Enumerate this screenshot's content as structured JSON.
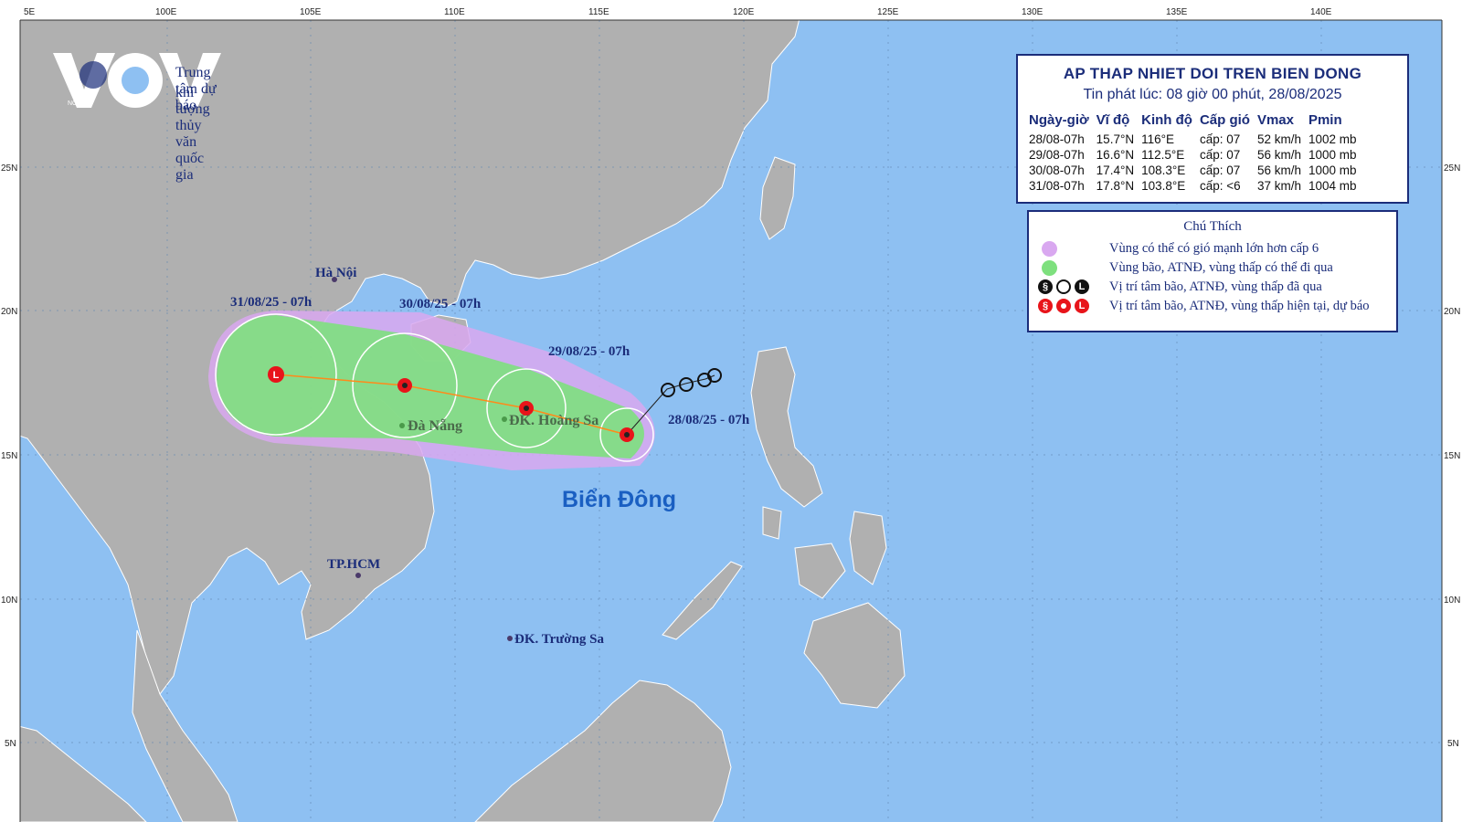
{
  "logo": {
    "brand": "VOV",
    "org_line1": "Trung tâm dự báo",
    "org_line2": "khí tượng thủy văn quốc gia",
    "badge": "NCHMF"
  },
  "grid": {
    "lon_labels": [
      "100E",
      "105E",
      "110E",
      "115E",
      "120E",
      "125E",
      "130E",
      "135E",
      "140E"
    ],
    "lat_labels": [
      "25N",
      "20N",
      "15N",
      "10N",
      "5N"
    ],
    "corner_label": "5E"
  },
  "places": {
    "hanoi": "Hà Nội",
    "danang": "Đà Nẵng",
    "hoangsa": "ĐK. Hoàng Sa",
    "tphcm": "TP.HCM",
    "truongsa": "ĐK. Trường Sa",
    "sea": "Biển Đông"
  },
  "track_labels": {
    "p1": "28/08/25 - 07h",
    "p2": "29/08/25 - 07h",
    "p3": "30/08/25 - 07h",
    "p4": "31/08/25 - 07h"
  },
  "info": {
    "title": "AP THAP NHIET DOI TREN BIEN DONG",
    "subtitle": "Tin phát lúc: 08 giờ 00 phút, 28/08/2025",
    "headers": [
      "Ngày-giờ",
      "Vĩ độ",
      "Kinh độ",
      "Cấp gió",
      "Vmax",
      "Pmin"
    ],
    "rows": [
      [
        "28/08-07h",
        "15.7°N",
        "116°E",
        "cấp: 07",
        "52 km/h",
        "1002 mb"
      ],
      [
        "29/08-07h",
        "16.6°N",
        "112.5°E",
        "cấp: 07",
        "56 km/h",
        "1000 mb"
      ],
      [
        "30/08-07h",
        "17.4°N",
        "108.3°E",
        "cấp: 07",
        "56 km/h",
        "1000 mb"
      ],
      [
        "31/08-07h",
        "17.8°N",
        "103.8°E",
        "cấp: <6",
        "37 km/h",
        "1004 mb"
      ]
    ]
  },
  "legend": {
    "title": "Chú Thích",
    "items": [
      "Vùng có thể có gió mạnh lớn hơn cấp 6",
      "Vùng bão, ATNĐ, vùng thấp có thể đi qua",
      "Vị trí tâm bão, ATNĐ, vùng thấp đã qua",
      "Vị trí tâm bão, ATNĐ, vùng thấp hiện tại, dự báo"
    ]
  },
  "colors": {
    "ocean": "#8ec0f2",
    "land": "#b0b0b0",
    "gale_zone": "#d9a8f0",
    "track_zone": "#7ee07e",
    "center": "#e8141a",
    "label_blue": "#1b2d7a",
    "sea_label": "#1a5fc2"
  }
}
